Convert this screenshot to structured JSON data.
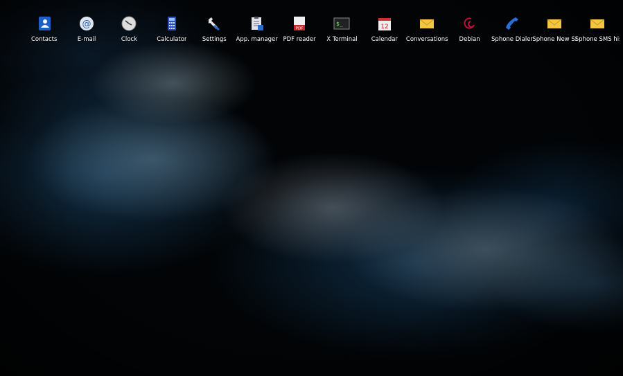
{
  "apps": [
    {
      "label": "Contacts",
      "icon": "contacts-icon"
    },
    {
      "label": "E-mail",
      "icon": "email-icon"
    },
    {
      "label": "Clock",
      "icon": "clock-icon"
    },
    {
      "label": "Calculator",
      "icon": "calculator-icon"
    },
    {
      "label": "Settings",
      "icon": "wrench-icon"
    },
    {
      "label": "App. manager",
      "icon": "clipboard-icon"
    },
    {
      "label": "PDF reader",
      "icon": "pdf-icon",
      "icon_text": "PDF"
    },
    {
      "label": "X Terminal",
      "icon": "terminal-icon",
      "icon_text": "$_"
    },
    {
      "label": "Calendar",
      "icon": "calendar-icon",
      "icon_text": "12"
    },
    {
      "label": "Conversations",
      "icon": "envelope-icon"
    },
    {
      "label": "Debian",
      "icon": "debian-swirl-icon"
    },
    {
      "label": "Sphone Dialer",
      "icon": "phone-handset-icon"
    },
    {
      "label": "Sphone New SM-",
      "icon": "envelope-icon"
    },
    {
      "label": "Sphone SMS hist-",
      "icon": "envelope-icon"
    }
  ]
}
